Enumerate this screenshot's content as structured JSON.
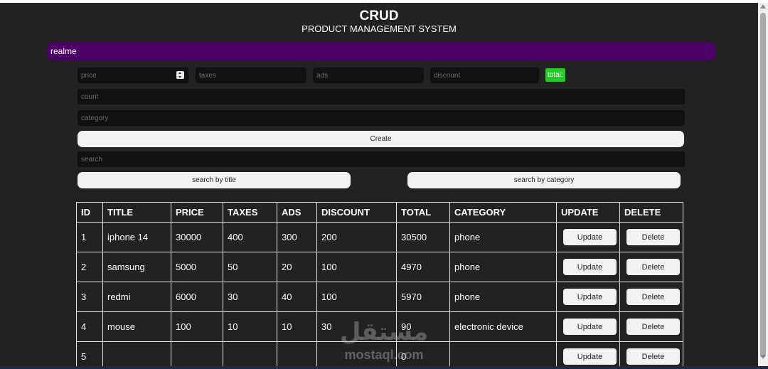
{
  "header": {
    "title": "CRUD",
    "subtitle": "PRODUCT MANAGEMENT SYSTEM"
  },
  "preview": {
    "text": "realme"
  },
  "form": {
    "price_placeholder": "price",
    "taxes_placeholder": "taxes",
    "ads_placeholder": "ads",
    "discount_placeholder": "discount",
    "total_label": "total:",
    "count_placeholder": "count",
    "category_placeholder": "category",
    "create_label": "Create",
    "search_placeholder": "search",
    "search_title_label": "search by title",
    "search_category_label": "search by category"
  },
  "table": {
    "headers": [
      "ID",
      "TITLE",
      "PRICE",
      "TAXES",
      "ADS",
      "DISCOUNT",
      "TOTAL",
      "CATEGORY",
      "UPDATE",
      "DELETE"
    ],
    "update_label": "Update",
    "delete_label": "Delete",
    "rows": [
      {
        "id": "1",
        "title": "iphone 14",
        "price": "30000",
        "taxes": "400",
        "ads": "300",
        "discount": "200",
        "total": "30500",
        "category": "phone"
      },
      {
        "id": "2",
        "title": "samsung",
        "price": "5000",
        "taxes": "50",
        "ads": "20",
        "discount": "100",
        "total": "4970",
        "category": "phone"
      },
      {
        "id": "3",
        "title": "redmi",
        "price": "6000",
        "taxes": "30",
        "ads": "40",
        "discount": "100",
        "total": "5970",
        "category": "phone"
      },
      {
        "id": "4",
        "title": "mouse",
        "price": "100",
        "taxes": "10",
        "ads": "10",
        "discount": "30",
        "total": "90",
        "category": "electronic device"
      },
      {
        "id": "5",
        "title": "",
        "price": "",
        "taxes": "",
        "ads": "",
        "discount": "",
        "total": "0",
        "category": ""
      }
    ]
  },
  "watermark": {
    "arabic": "مستقل",
    "latin": "mostaql.com"
  },
  "colors": {
    "background": "#222222",
    "preview_bar": "#4d0066",
    "input_bg": "#111111",
    "total_badge": "#22cc22",
    "button_bg": "#f2f2f2"
  }
}
